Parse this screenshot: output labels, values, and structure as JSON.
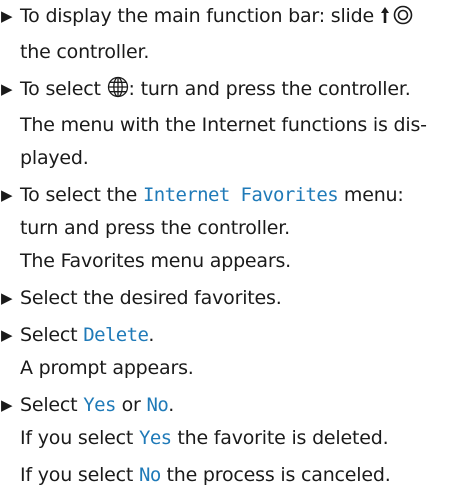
{
  "steps": [
    {
      "lines": [
        [
          {
            "t": "To display the main function bar: slide "
          },
          {
            "icon": "slide-up-controller-icon"
          },
          {
            "t": ""
          }
        ],
        [
          {
            "t": "the controller."
          }
        ]
      ]
    },
    {
      "lines": [
        [
          {
            "t": "To select "
          },
          {
            "icon": "globe-icon"
          },
          {
            "t": ": turn and press the controller."
          }
        ],
        [
          {
            "t": "The menu with the Internet functions is dis-"
          }
        ],
        [
          {
            "t": "played."
          }
        ]
      ]
    },
    {
      "lines": [
        [
          {
            "t": "To select the "
          },
          {
            "hl": "Internet Favorites"
          },
          {
            "t": " menu:"
          }
        ],
        [
          {
            "t": "turn and press the controller."
          }
        ],
        [
          {
            "t": "The Favorites menu appears."
          }
        ]
      ]
    },
    {
      "lines": [
        [
          {
            "t": "Select the desired favorites."
          }
        ]
      ]
    },
    {
      "lines": [
        [
          {
            "t": "Select "
          },
          {
            "hl": "Delete"
          },
          {
            "t": "."
          }
        ],
        [
          {
            "t": "A prompt appears."
          }
        ]
      ]
    },
    {
      "lines": [
        [
          {
            "t": "Select "
          },
          {
            "hl": "Yes"
          },
          {
            "t": " or "
          },
          {
            "hl": "No"
          },
          {
            "t": "."
          }
        ],
        [
          {
            "t": "If you select "
          },
          {
            "hl": "Yes"
          },
          {
            "t": " the favorite is deleted."
          }
        ]
      ],
      "after": [
        [
          {
            "t": "If you select "
          },
          {
            "hl": "No"
          },
          {
            "t": " the process is canceled."
          }
        ]
      ]
    }
  ],
  "bullet": "▶",
  "colors": {
    "highlight": "#1f7ab8",
    "text": "#1a1a1a"
  }
}
